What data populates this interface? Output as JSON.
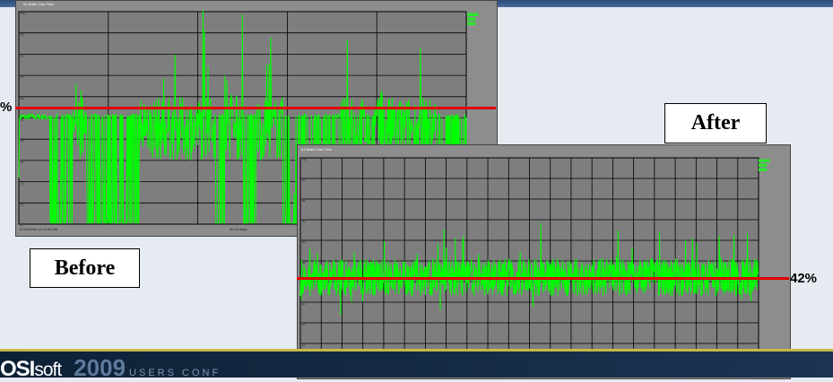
{
  "slide": {
    "before_label": "Before",
    "after_label": "After",
    "before_percent_visible": "%",
    "after_percent": "42%",
    "reference_line_color": "#e00000",
    "trend_color": "#00ff00"
  },
  "before_trend": {
    "title": "#1 Boiler Gas Flow",
    "start_time": "11/18/2008 12:00:00 AM",
    "span": "30.00 days",
    "y_ticks": [
      "100",
      "90",
      "80",
      "70",
      "60",
      "50",
      "40",
      "30",
      "20",
      "10",
      "0"
    ]
  },
  "after_trend": {
    "title": "#1 Boiler Gas Flow",
    "start_time": "6/7/2008 12:00:00 AM",
    "span": "27.00 days",
    "end_time": "7/4/2008 12:00:00 AM",
    "y_ticks": [
      "100",
      "90",
      "80",
      "70",
      "60",
      "50",
      "40",
      "30",
      "20",
      "10",
      "0"
    ]
  },
  "footer": {
    "brand_bold": "OSI",
    "brand_rest": "soft",
    "year": "2009",
    "conference": "USERS CONF"
  }
}
